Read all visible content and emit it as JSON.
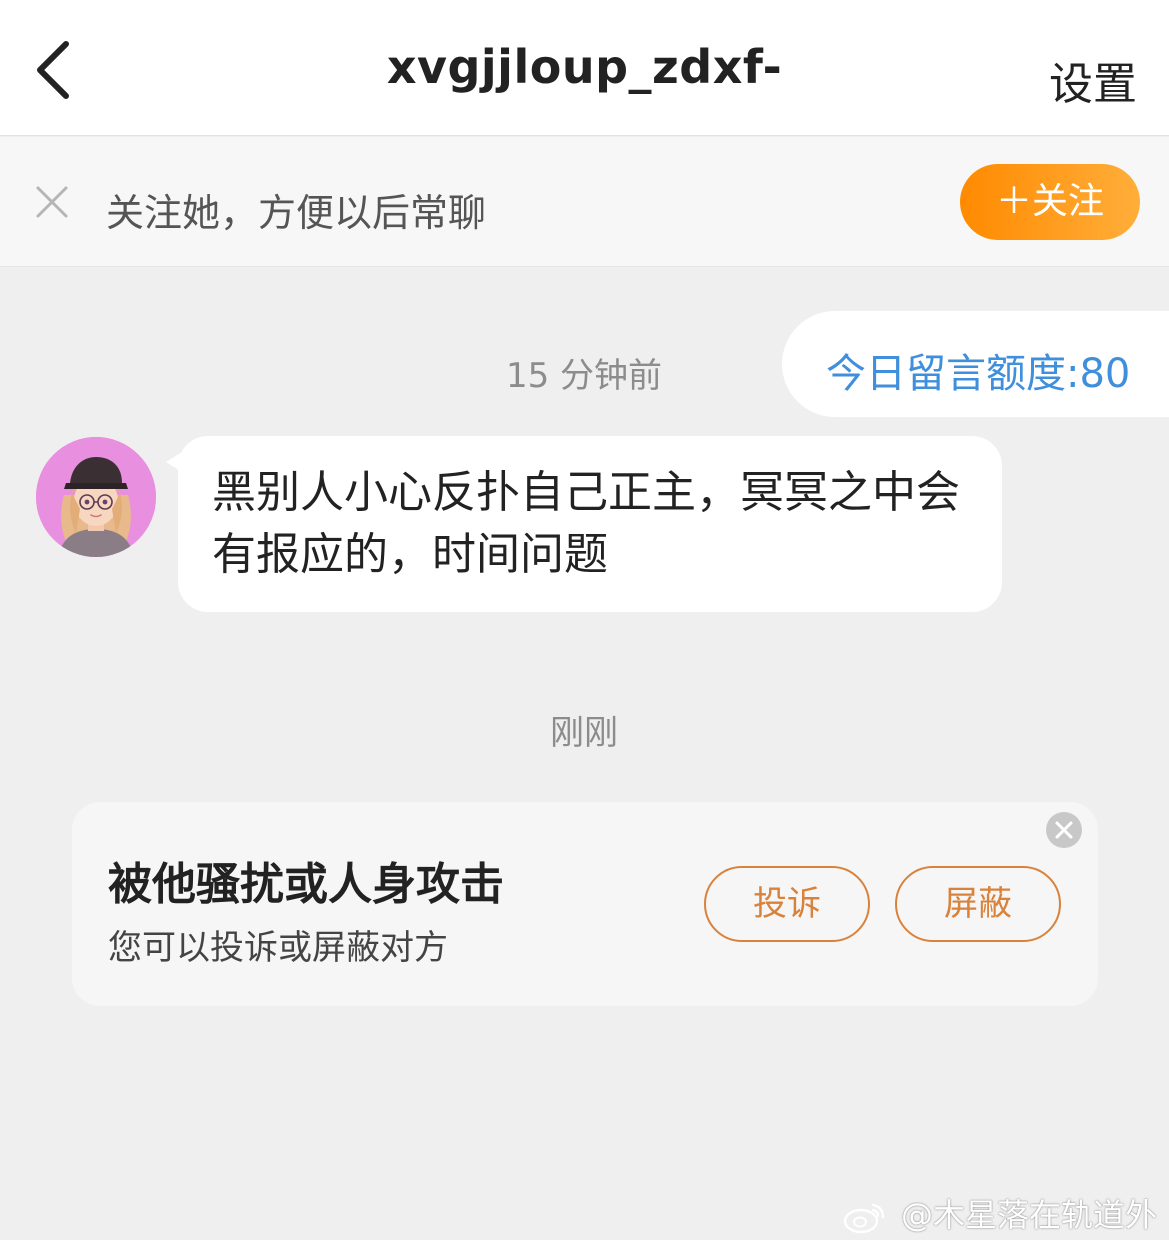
{
  "header": {
    "title": "xvgjjloup_zdxf-",
    "settings_label": "设置",
    "back_icon": "chevron-left-icon"
  },
  "follow_bar": {
    "text": "关注她，方便以后常聊",
    "button_label": "＋关注",
    "close_icon": "close-icon"
  },
  "quota": {
    "text": "今日留言额度:80"
  },
  "messages": [
    {
      "timestamp": "15 分钟前",
      "text": "黑别人小心反扑自己正主，冥冥之中会有报应的，时间问题"
    }
  ],
  "notice": {
    "timestamp": "刚刚",
    "title": "被他骚扰或人身攻击",
    "subtitle": "您可以投诉或屏蔽对方",
    "report_label": "投诉",
    "block_label": "屏蔽"
  },
  "watermark": {
    "text": "@木星落在轨道外"
  },
  "colors": {
    "accent_orange": "#ff8a00",
    "link_blue": "#3f8fdc",
    "button_outline": "#d9823b"
  }
}
